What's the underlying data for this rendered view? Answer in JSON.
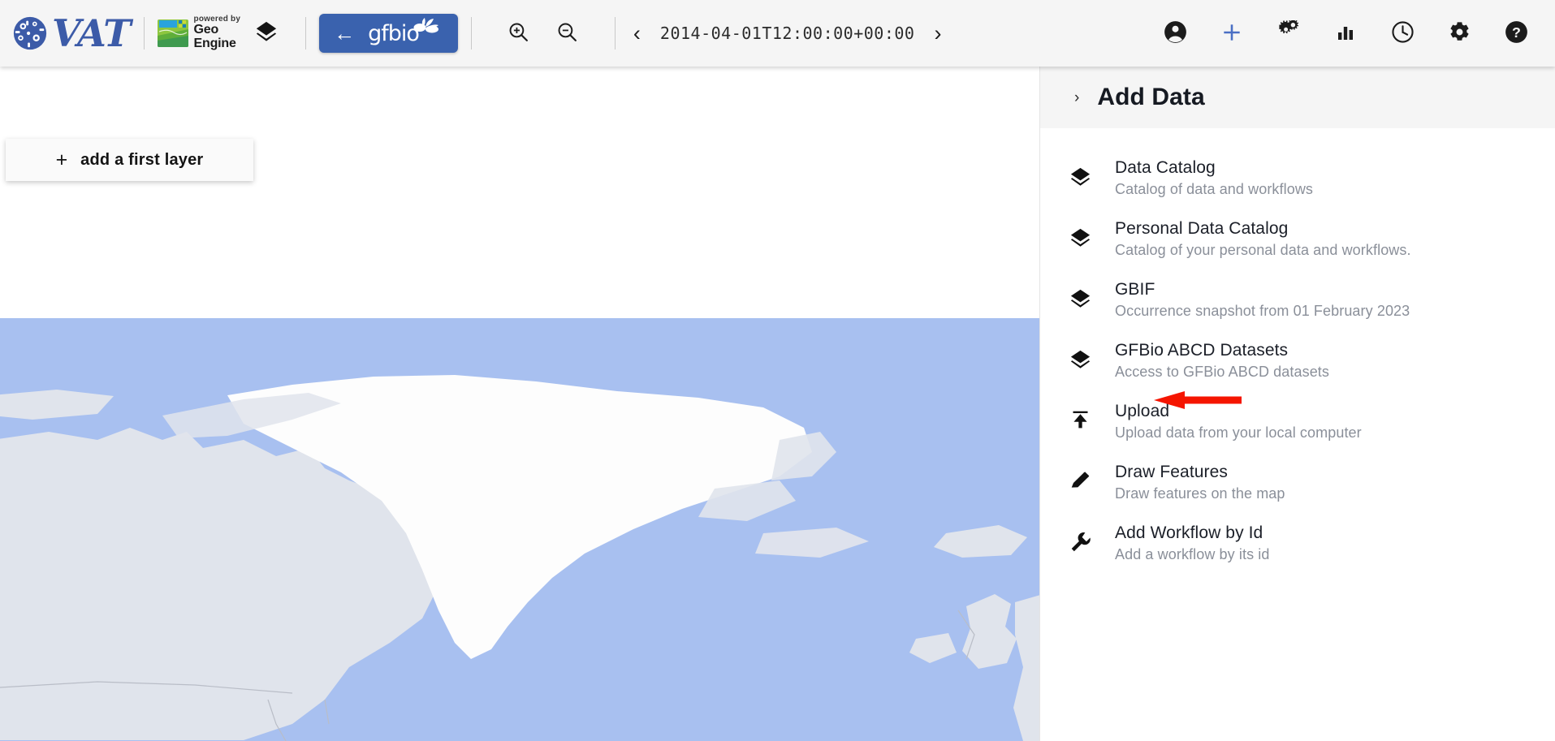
{
  "toolbar": {
    "brand_name": "VAT",
    "globe_icon": "globe-icon",
    "geo_engine": {
      "powered_by": "powered by",
      "name_line1": "Geo",
      "name_line2": "Engine",
      "icon": "map-tile-icon"
    },
    "layers_icon": "layers-icon",
    "gfbio_button": {
      "back_icon": "arrow-back-icon",
      "label": "gfbio",
      "color": "#3a62ae"
    },
    "zoom_in_icon": "zoom-in-icon",
    "zoom_out_icon": "zoom-out-icon",
    "time_prev_icon": "chevron-left-icon",
    "time_next_icon": "chevron-right-icon",
    "timestamp": "2014-04-01T12:00:00+00:00",
    "right_icons": [
      {
        "name": "account-circle-icon",
        "color": "#1c1c1c"
      },
      {
        "name": "plus-icon",
        "color": "#4a6fc4"
      },
      {
        "name": "workflow-gears-icon",
        "color": "#1c1c1c"
      },
      {
        "name": "bar-chart-icon",
        "color": "#1c1c1c"
      },
      {
        "name": "clock-history-icon",
        "color": "#1c1c1c"
      },
      {
        "name": "settings-gear-icon",
        "color": "#1c1c1c"
      },
      {
        "name": "help-icon",
        "color": "#1c1c1c"
      }
    ]
  },
  "map": {
    "add_first_layer": {
      "plus": "+",
      "label": "add a first layer"
    },
    "ocean_color": "#a8c0f0",
    "land_color": "#e0e4ec",
    "ice_color": "#fdfdfd"
  },
  "panel": {
    "header": {
      "chevron": "›",
      "title": "Add Data"
    },
    "items": [
      {
        "icon": "layers-icon",
        "title": "Data Catalog",
        "subtitle": "Catalog of data and workflows"
      },
      {
        "icon": "layers-icon",
        "title": "Personal Data Catalog",
        "subtitle": "Catalog of your personal data and workflows."
      },
      {
        "icon": "layers-icon",
        "title": "GBIF",
        "subtitle": "Occurrence snapshot from 01 February 2023"
      },
      {
        "icon": "layers-icon",
        "title": "GFBio ABCD Datasets",
        "subtitle": "Access to GFBio ABCD datasets"
      },
      {
        "icon": "upload-icon",
        "title": "Upload",
        "subtitle": "Upload data from your local computer"
      },
      {
        "icon": "pencil-icon",
        "title": "Draw Features",
        "subtitle": "Draw features on the map"
      },
      {
        "icon": "wrench-icon",
        "title": "Add Workflow by Id",
        "subtitle": "Add a workflow by its id"
      }
    ]
  },
  "annotation": {
    "arrow": "red-arrow-pointing-left",
    "color": "#f51500"
  }
}
